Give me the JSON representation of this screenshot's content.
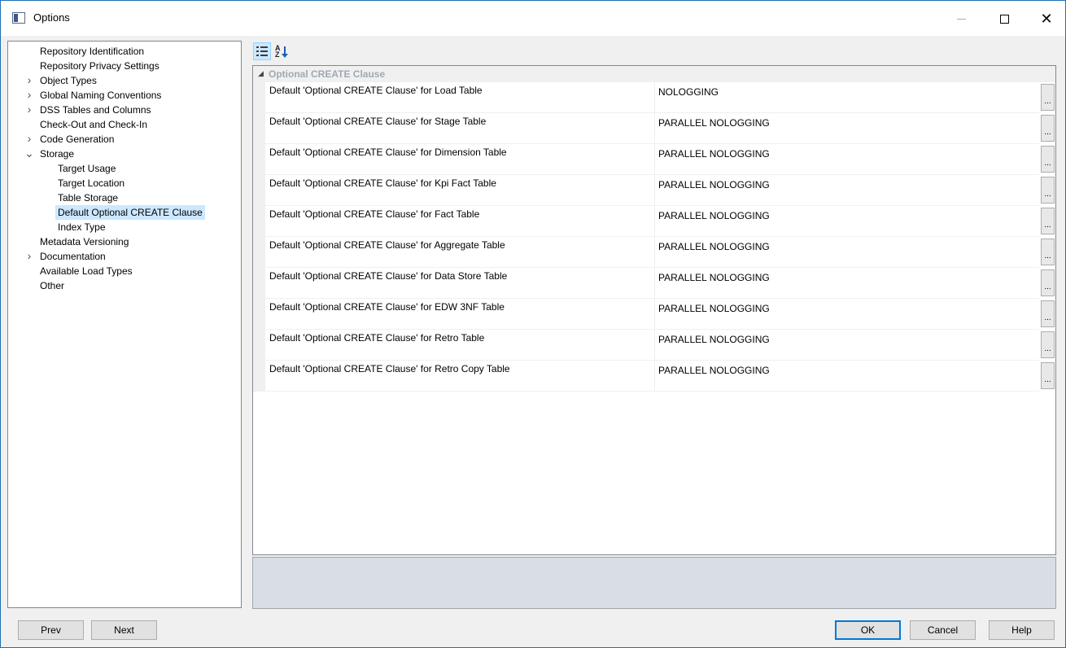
{
  "window": {
    "title": "Options",
    "icons": {
      "app": "window-app-icon",
      "minimize": "minimize-icon",
      "maximize": "maximize-icon",
      "close": "close-icon"
    },
    "close_glyph": "✕"
  },
  "tree": {
    "items": [
      {
        "label": "Repository Identification",
        "level": 0,
        "expander": ""
      },
      {
        "label": "Repository Privacy Settings",
        "level": 0,
        "expander": ""
      },
      {
        "label": "Object Types",
        "level": 0,
        "expander": ">"
      },
      {
        "label": "Global Naming Conventions",
        "level": 0,
        "expander": ">"
      },
      {
        "label": "DSS Tables and Columns",
        "level": 0,
        "expander": ">"
      },
      {
        "label": "Check-Out and Check-In",
        "level": 0,
        "expander": ""
      },
      {
        "label": "Code Generation",
        "level": 0,
        "expander": ">"
      },
      {
        "label": "Storage",
        "level": 0,
        "expander": "v"
      },
      {
        "label": "Target Usage",
        "level": 1,
        "expander": ""
      },
      {
        "label": "Target Location",
        "level": 1,
        "expander": ""
      },
      {
        "label": "Table Storage",
        "level": 1,
        "expander": ""
      },
      {
        "label": "Default Optional CREATE Clause",
        "level": 1,
        "expander": "",
        "selected": true
      },
      {
        "label": "Index Type",
        "level": 1,
        "expander": ""
      },
      {
        "label": "Metadata Versioning",
        "level": 0,
        "expander": ""
      },
      {
        "label": "Documentation",
        "level": 0,
        "expander": ">"
      },
      {
        "label": "Available Load Types",
        "level": 0,
        "expander": ""
      },
      {
        "label": "Other",
        "level": 0,
        "expander": ""
      }
    ]
  },
  "toolbar": {
    "categorized_icon": "categorized-view-icon",
    "alphabetical_icon": "sort-alphabetical-icon",
    "alphabetical_glyph": "A\nZ"
  },
  "property_grid": {
    "category": "Optional CREATE Clause",
    "collapse_glyph": "◢",
    "ellipsis_label": "...",
    "rows": [
      {
        "name": "Default 'Optional CREATE Clause' for Load Table",
        "value": "NOLOGGING"
      },
      {
        "name": "Default 'Optional CREATE Clause' for Stage Table",
        "value": "PARALLEL NOLOGGING"
      },
      {
        "name": "Default 'Optional CREATE Clause' for Dimension Table",
        "value": "PARALLEL NOLOGGING"
      },
      {
        "name": "Default 'Optional CREATE Clause' for Kpi Fact Table",
        "value": "PARALLEL NOLOGGING"
      },
      {
        "name": "Default 'Optional CREATE Clause' for Fact Table",
        "value": "PARALLEL NOLOGGING"
      },
      {
        "name": "Default 'Optional CREATE Clause' for Aggregate Table",
        "value": "PARALLEL NOLOGGING"
      },
      {
        "name": "Default 'Optional CREATE Clause' for Data Store Table",
        "value": "PARALLEL NOLOGGING"
      },
      {
        "name": "Default 'Optional CREATE Clause' for EDW 3NF Table",
        "value": "PARALLEL NOLOGGING"
      },
      {
        "name": "Default 'Optional CREATE Clause' for Retro Table",
        "value": "PARALLEL NOLOGGING"
      },
      {
        "name": "Default 'Optional CREATE Clause' for Retro Copy Table",
        "value": "PARALLEL NOLOGGING"
      }
    ]
  },
  "buttons": {
    "prev": "Prev",
    "next": "Next",
    "ok": "OK",
    "cancel": "Cancel",
    "help": "Help"
  },
  "colors": {
    "selection": "#cce8ff",
    "window_border": "#1f6fb5",
    "category_text": "#a0a8b4",
    "description_panel": "#d9dde4"
  }
}
